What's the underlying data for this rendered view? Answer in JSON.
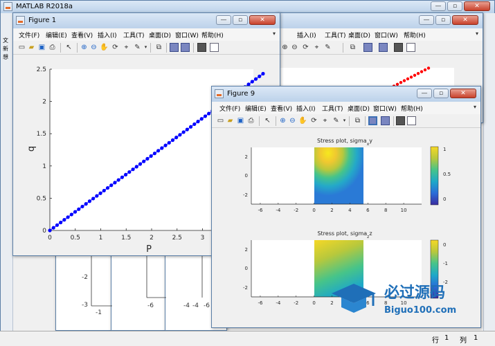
{
  "main": {
    "title": "MATLAB R2018a",
    "left_strip": [
      "文",
      "新",
      "想"
    ]
  },
  "menu_labels": [
    "文件(F)",
    "编辑(E)",
    "查看(V)",
    "插入(I)",
    "工具(T)",
    "桌面(D)",
    "窗口(W)",
    "帮助(H)"
  ],
  "mid_menu_labels": [
    "插入(I)",
    "工具(T)",
    "桌面(D)",
    "窗口(W)",
    "帮助(H)"
  ],
  "figure1": {
    "title": "Figure 1",
    "xlabel": "P",
    "ylabel": "q",
    "xticks": [
      "0",
      "0.5",
      "1",
      "1.5",
      "2",
      "2.5",
      "3",
      "3.5"
    ],
    "yticks": [
      "0",
      "0.5",
      "1",
      "1.5",
      "2",
      "2.5"
    ]
  },
  "figure9": {
    "title": "Figure 9",
    "plot1_title": "Stress plot, sigma",
    "plot1_sub": "x",
    "plot1_suffix": "y",
    "plot2_title": "Stress plot, sigma",
    "plot2_sub": "z",
    "plot2_suffix": "z",
    "xticks": [
      "-6",
      "-4",
      "-2",
      "0",
      "2",
      "4",
      "6",
      "8",
      "10"
    ],
    "yticks1": [
      "2",
      "0",
      "-2"
    ],
    "cb1": [
      "1",
      "0.5",
      "0"
    ],
    "cb2": [
      "0",
      "-1",
      "-2"
    ]
  },
  "background": {
    "ticks": [
      "-2",
      "-3",
      "-1",
      "-6",
      "-4",
      "-6",
      "-4"
    ]
  },
  "watermark": {
    "title": "必过源码",
    "url": "Biguo100.com"
  },
  "statusbar": {
    "row_label": "行",
    "row_value": "1",
    "col_label": "列",
    "col_value": "1"
  },
  "colors": {
    "line_blue": "#0000ff",
    "line_red": "#ff0000",
    "title_bar": "#bcd2ea",
    "colormap": [
      "#3a2ca0",
      "#2a6cd8",
      "#1ea8c8",
      "#46c48a",
      "#b8c83c",
      "#f6d826"
    ]
  },
  "chart_data": [
    {
      "type": "scatter",
      "title": "",
      "xlabel": "P",
      "ylabel": "q",
      "xlim": [
        0,
        4
      ],
      "ylim": [
        0,
        2.5
      ],
      "series": [
        {
          "x_start": 0,
          "x_end": 4.19,
          "slope": 0.58,
          "points": 60,
          "color": "#0000ff"
        }
      ]
    },
    {
      "type": "heatmap",
      "title": "Stress plot, sigma_x y",
      "xlim": [
        -7,
        12
      ],
      "ylim": [
        -3,
        3
      ],
      "colorbar": [
        0,
        1
      ]
    },
    {
      "type": "heatmap",
      "title": "Stress plot, sigma_z z",
      "xlim": [
        -7,
        12
      ],
      "ylim": [
        -3,
        3
      ],
      "colorbar": [
        -2,
        0
      ]
    }
  ]
}
